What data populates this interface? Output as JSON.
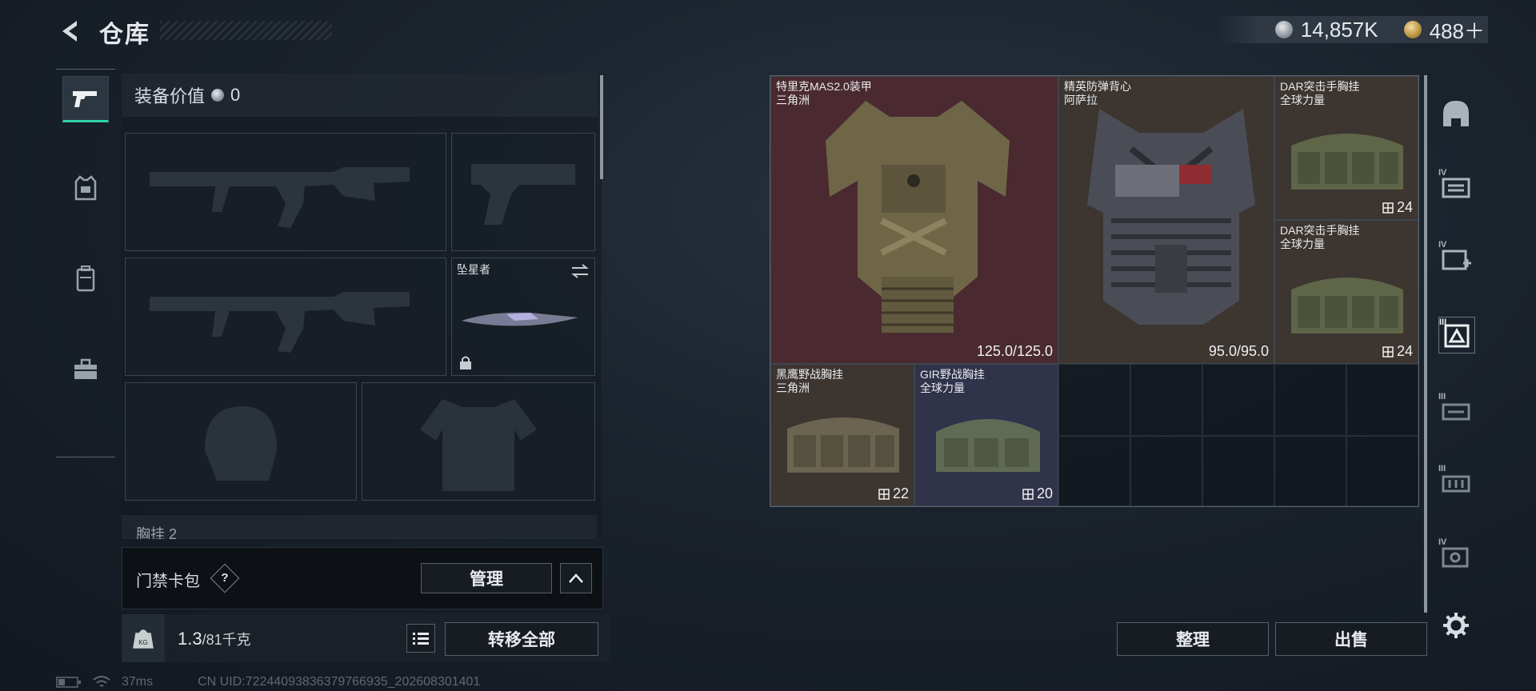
{
  "header": {
    "title": "仓库",
    "currency_silver": "14,857K",
    "currency_gold": "488＋",
    "colors": {
      "accent": "#2fd3a6"
    }
  },
  "left_tabs": [
    {
      "icon": "pistol-icon",
      "active": true
    },
    {
      "icon": "armor-vest-icon",
      "active": false
    },
    {
      "icon": "backpack-icon",
      "active": false
    },
    {
      "icon": "toolbox-icon",
      "active": false
    }
  ],
  "equipment": {
    "value_label": "装备价值",
    "value": "0",
    "melee_name": "坠星者",
    "chest_label": "胸挂",
    "chest_count": "2"
  },
  "keycard": {
    "label": "门禁卡包",
    "help": "?",
    "manage_label": "管理"
  },
  "weight": {
    "current": "1.3",
    "max": "/81千克",
    "transfer_all_label": "转移全部"
  },
  "status": {
    "ping": "37ms",
    "uid": "CN UID:72244093836379766935_202608301401"
  },
  "stash_items": [
    {
      "name1": "特里克MAS2.0装甲",
      "name2": "三角洲",
      "durability": "125.0/125.0",
      "bg": "#4a2a30"
    },
    {
      "name1": "精英防弹背心",
      "name2": "阿萨拉",
      "durability": "95.0/95.0",
      "bg": "#3c3530"
    },
    {
      "name1": "DAR突击手胸挂",
      "name2": "全球力量",
      "capacity": "24",
      "bg": "#3c3530"
    },
    {
      "name1": "DAR突击手胸挂",
      "name2": "全球力量",
      "capacity": "24",
      "bg": "#3c3530"
    },
    {
      "name1": "黑鹰野战胸挂",
      "name2": "三角洲",
      "capacity": "22",
      "bg": "#3c3530"
    },
    {
      "name1": "GIR野战胸挂",
      "name2": "全球力量",
      "capacity": "20",
      "bg": "#30334a"
    }
  ],
  "sidebar_tiers": [
    "IV",
    "IV",
    "III",
    "III",
    "IV"
  ],
  "actions": {
    "sort_label": "整理",
    "sell_label": "出售"
  }
}
